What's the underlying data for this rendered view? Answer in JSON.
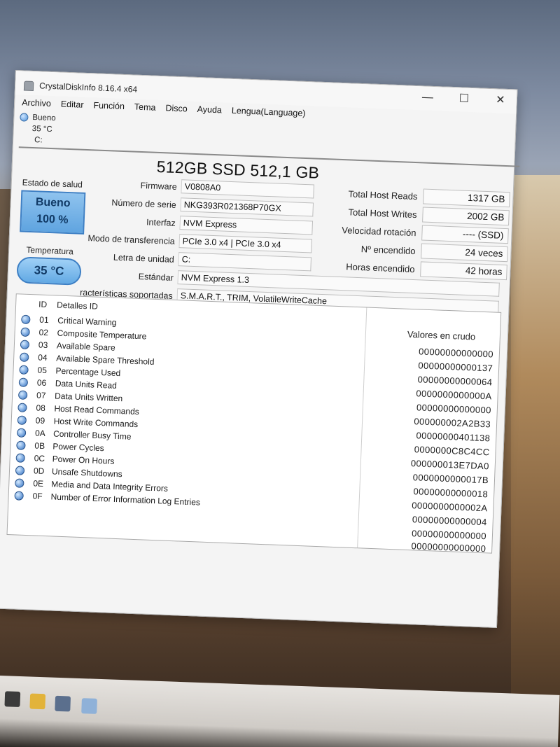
{
  "window": {
    "title": "CrystalDiskInfo 8.16.4 x64",
    "minimize": "—",
    "maximize": "☐",
    "close": "✕"
  },
  "menu": [
    "Archivo",
    "Editar",
    "Función",
    "Tema",
    "Disco",
    "Ayuda",
    "Lengua(Language)"
  ],
  "disk_tab": {
    "status": "Bueno",
    "temp": "35 °C",
    "letter": "C:"
  },
  "disk_title": "512GB SSD 512,1 GB",
  "health": {
    "label": "Estado de salud",
    "status": "Bueno",
    "percent": "100 %"
  },
  "temperature": {
    "label": "Temperatura",
    "value": "35 °C"
  },
  "fields": [
    {
      "label": "Firmware",
      "value": "V0808A0"
    },
    {
      "label": "Número de serie",
      "value": "NKG393R021368P70GX"
    },
    {
      "label": "Interfaz",
      "value": "NVM Express"
    },
    {
      "label": "Modo de transferencia",
      "value": "PCIe 3.0 x4 | PCIe 3.0 x4"
    },
    {
      "label": "Letra de unidad",
      "value": "C:"
    },
    {
      "label": "Estándar",
      "value": "NVM Express 1.3"
    },
    {
      "label": "racterísticas soportadas",
      "value": "S.M.A.R.T., TRIM, VolatileWriteCache"
    }
  ],
  "right_fields": [
    {
      "label": "Total Host Reads",
      "value": "1317 GB"
    },
    {
      "label": "Total Host Writes",
      "value": "2002 GB"
    },
    {
      "label": "Velocidad rotación",
      "value": "---- (SSD)"
    },
    {
      "label": "Nº encendido",
      "value": "24 veces"
    },
    {
      "label": "Horas encendido",
      "value": "42 horas"
    }
  ],
  "table": {
    "col_id": "ID",
    "col_name": "Detalles ID",
    "col_raw": "Valores en crudo",
    "rows": [
      {
        "id": "01",
        "name": "Critical Warning",
        "raw": "00000000000000"
      },
      {
        "id": "02",
        "name": "Composite Temperature",
        "raw": "00000000000137"
      },
      {
        "id": "03",
        "name": "Available Spare",
        "raw": "00000000000064"
      },
      {
        "id": "04",
        "name": "Available Spare Threshold",
        "raw": "0000000000000A"
      },
      {
        "id": "05",
        "name": "Percentage Used",
        "raw": "00000000000000"
      },
      {
        "id": "06",
        "name": "Data Units Read",
        "raw": "000000002A2B33"
      },
      {
        "id": "07",
        "name": "Data Units Written",
        "raw": "00000000401138"
      },
      {
        "id": "08",
        "name": "Host Read Commands",
        "raw": "0000000C8C4CC"
      },
      {
        "id": "09",
        "name": "Host Write Commands",
        "raw": "000000013E7DA0"
      },
      {
        "id": "0A",
        "name": "Controller Busy Time",
        "raw": "0000000000017B"
      },
      {
        "id": "0B",
        "name": "Power Cycles",
        "raw": "00000000000018"
      },
      {
        "id": "0C",
        "name": "Power On Hours",
        "raw": "0000000000002A"
      },
      {
        "id": "0D",
        "name": "Unsafe Shutdowns",
        "raw": "00000000000004"
      },
      {
        "id": "0E",
        "name": "Media and Data Integrity Errors",
        "raw": "00000000000000"
      },
      {
        "id": "0F",
        "name": "Number of Error Information Log Entries",
        "raw": "00000000000000"
      }
    ]
  },
  "colors": {
    "health_blue": "#5fa4e0",
    "dot_blue": "#2f6fc2"
  }
}
